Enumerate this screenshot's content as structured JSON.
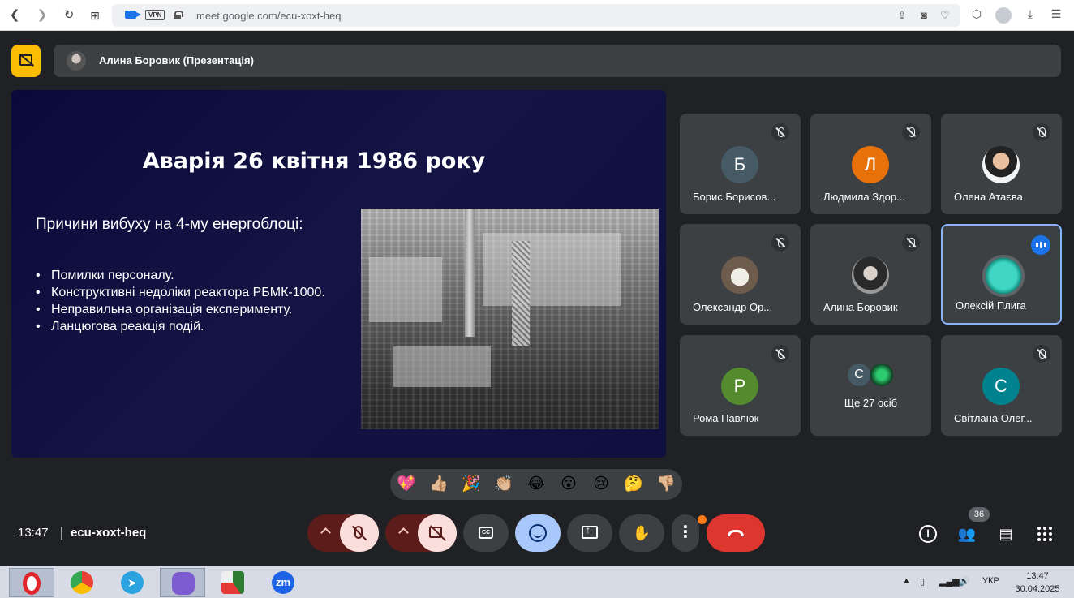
{
  "browser": {
    "url": "meet.google.com/ecu-xoxt-heq",
    "vpn_label": "VPN"
  },
  "meet": {
    "presenter_label": "Алина Боровик (Презентація)",
    "time": "13:47",
    "meeting_code": "ecu-xoxt-heq",
    "people_count": "36"
  },
  "slide": {
    "title": "Аварія 26 квітня 1986 року",
    "subtitle": "Причини вибуху на 4-му енергоблоці:",
    "bullets": [
      "Помилки персоналу.",
      "Конструктивні недоліки реактора РБМК-1000.",
      "Неправильна організація експерименту.",
      "Ланцюгова реакція подій."
    ]
  },
  "participants": [
    {
      "name": "Борис Борисов...",
      "initial": "Б",
      "color": "#455a64",
      "muted": true
    },
    {
      "name": "Людмила Здор...",
      "initial": "Л",
      "color": "#e8710a",
      "muted": true
    },
    {
      "name": "Олена Атаєва",
      "initial": "",
      "color": "#f1f3f4",
      "muted": true
    },
    {
      "name": "Олександр Ор...",
      "initial": "",
      "color": "#6d5b4b",
      "muted": true
    },
    {
      "name": "Алина Боровик",
      "initial": "",
      "color": "#777777",
      "muted": true
    },
    {
      "name": "Олексій Плига",
      "initial": "",
      "color": "#1fb5a0",
      "speaking": true
    },
    {
      "name": "Рома Павлюк",
      "initial": "Р",
      "color": "#558b2f",
      "muted": true
    },
    {
      "name": "Ще 27 осіб",
      "initial": "С",
      "color": "#455a64"
    },
    {
      "name": "Світлана Олег...",
      "initial": "С",
      "color": "#00838f",
      "muted": true
    }
  ],
  "reactions": [
    "💖",
    "👍🏼",
    "🎉",
    "👏🏼",
    "😂",
    "😮",
    "😢",
    "🤔",
    "👎🏼"
  ],
  "controls": {
    "cc_label": "CC"
  },
  "taskbar": {
    "lang": "УКР",
    "time": "13:47",
    "date": "30.04.2025"
  }
}
